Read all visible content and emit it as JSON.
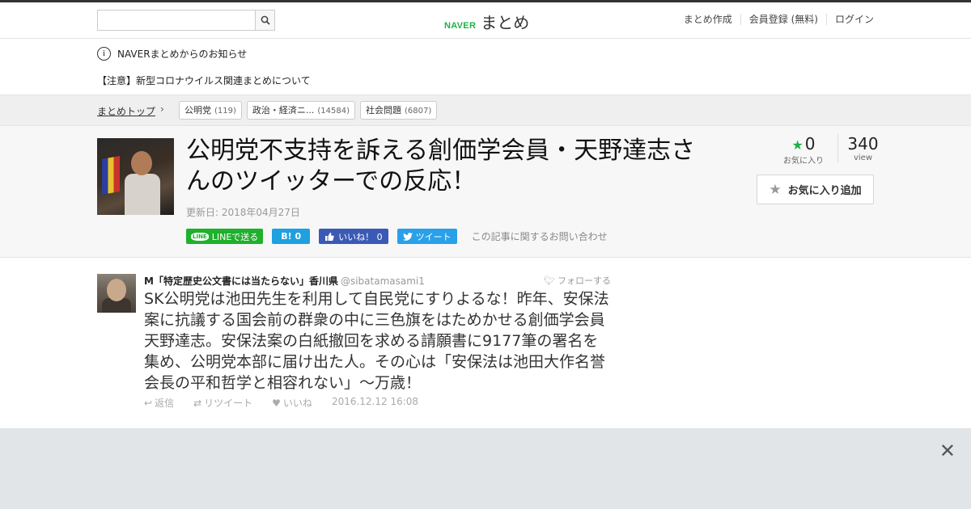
{
  "header": {
    "search": {
      "value": "",
      "placeholder": ""
    },
    "logo_naver": "NAVER",
    "logo_matome": "まとめ",
    "links": [
      "まとめ作成",
      "会員登録 (無料)",
      "ログイン"
    ]
  },
  "notice": {
    "heading": "NAVERまとめからのお知らせ",
    "item": "【注意】新型コロナウイルス関連まとめについて"
  },
  "breadcrumb": {
    "top": "まとめトップ",
    "tags": [
      {
        "label": "公明党",
        "count": "(119)"
      },
      {
        "label": "政治・経済ニ...",
        "count": "(14584)"
      },
      {
        "label": "社会問題",
        "count": "(6807)"
      }
    ]
  },
  "article": {
    "title": "公明党不支持を訴える創価学会員・天野達志さんのツイッターでの反応！",
    "updated": "更新日: 2018年04月27日",
    "favorites": "0",
    "favorites_label": "お気に入り",
    "views": "340",
    "views_label": "view",
    "fav_button": "お気に入り追加",
    "share": {
      "line": "LINEで送る",
      "line_icon": "LINE",
      "hatena": "B! 0",
      "facebook": "いいね！ 0",
      "twitter": "ツイート",
      "inquiry": "この記事に関するお問い合わせ"
    }
  },
  "tweet": {
    "name": "M「特定歴史公文書には当たらない」香川県",
    "handle": "@sibatamasami1",
    "follow": "フォローする",
    "text": "SK公明党は池田先生を利用して自民党にすりよるな！昨年、安保法案に抗議する国会前の群衆の中に三色旗をはためかせる創価学会員天野達志。安保法案の白紙撤回を求める請願書に9177筆の署名を集め、公明党本部に届け出た人。その心は「安保法は池田大作名誉会長の平和哲学と相容れない」～万歳！",
    "actions": {
      "reply": "返信",
      "retweet": "リツイート",
      "like": "いいね"
    },
    "timestamp": "2016.12.12 16:08"
  },
  "colors": {
    "brand_green": "#1fb246",
    "line_green": "#1fb02c",
    "hatena_blue": "#1fa0e0",
    "facebook_blue": "#3b5ab5",
    "twitter_blue": "#2aa0e8"
  },
  "icons": [
    "search-icon",
    "info-icon",
    "chevron-right-icon",
    "star-icon",
    "line-icon",
    "facebook-like-icon",
    "twitter-bird-icon",
    "reply-icon",
    "retweet-icon",
    "heart-icon",
    "close-icon"
  ]
}
